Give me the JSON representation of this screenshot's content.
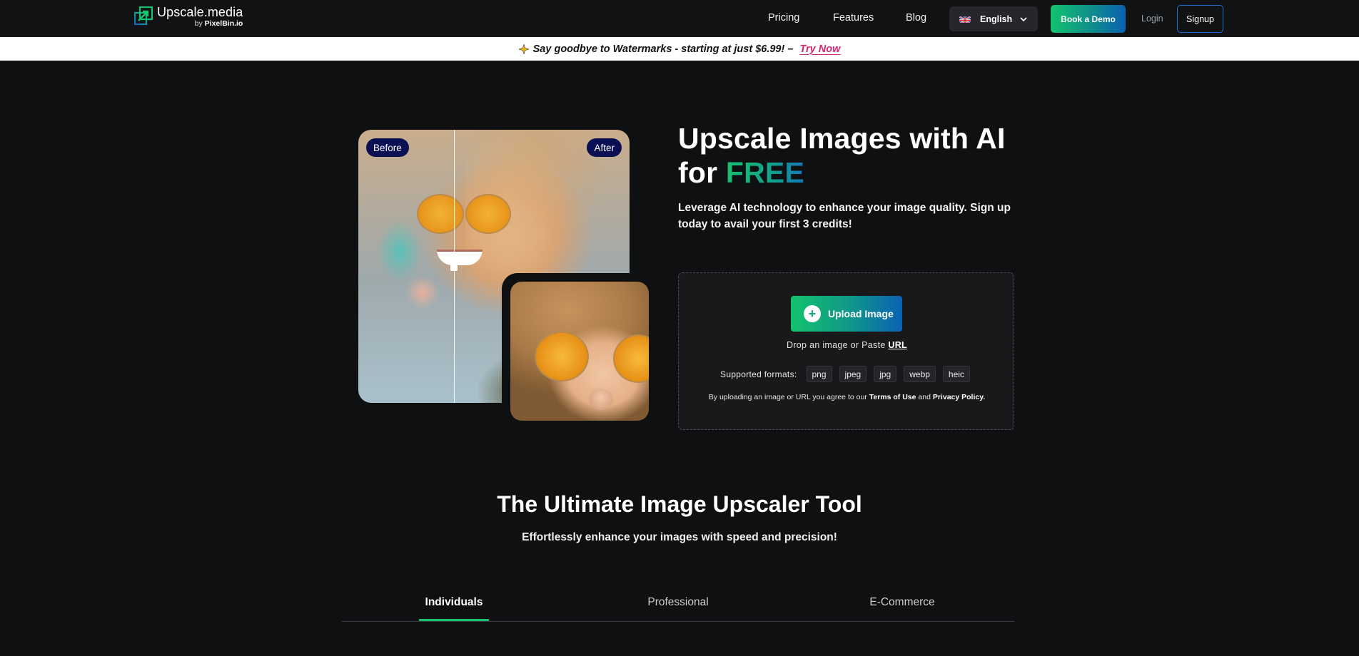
{
  "nav": {
    "logo_title": "Upscale.media",
    "logo_by": "by",
    "logo_brand": "PixelBin.io",
    "links": [
      "Pricing",
      "Features",
      "Blog"
    ],
    "language": "English",
    "book_demo": "Book a Demo",
    "login": "Login",
    "signup": "Signup"
  },
  "promo": {
    "text": "Say goodbye to Watermarks - starting at just $6.99! –",
    "cta": "Try Now"
  },
  "hero": {
    "title_line1": "Upscale Images with AI",
    "title_for": "for",
    "title_free": "FREE",
    "subtitle": "Leverage AI technology to enhance your image quality. Sign up today to avail your first 3 credits!",
    "before_label": "Before",
    "after_label": "After"
  },
  "upload": {
    "button_label": "Upload Image",
    "drop_text": "Drop an image or Paste",
    "url_label": "URL",
    "formats_label": "Supported formats:",
    "formats": [
      "png",
      "jpeg",
      "jpg",
      "webp",
      "heic"
    ],
    "terms_prefix": "By uploading an image or URL you agree to our",
    "terms_link": "Terms of Use",
    "terms_and": "and",
    "privacy_link": "Privacy Policy."
  },
  "section": {
    "title": "The Ultimate Image Upscaler Tool",
    "subtitle": "Effortlessly enhance your images with speed and precision!",
    "tabs": [
      "Individuals",
      "Professional",
      "E-Commerce"
    ],
    "active_tab": "Individuals"
  },
  "colors": {
    "accent_green": "#14c36d",
    "accent_blue": "#0a62b4",
    "promo_link": "#d6246e",
    "tag_bg": "#0b0f54"
  }
}
